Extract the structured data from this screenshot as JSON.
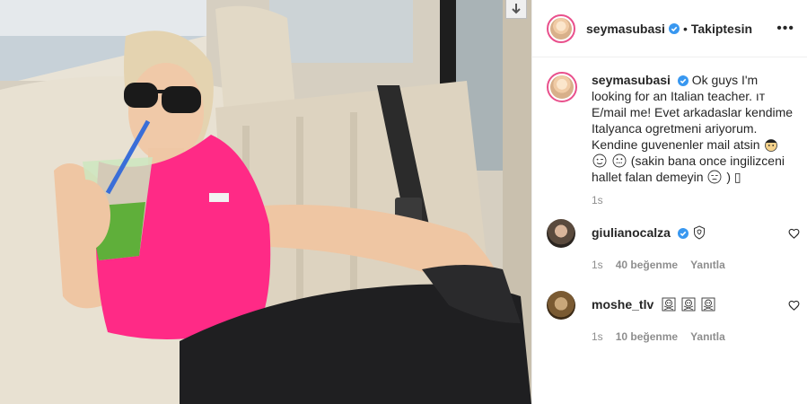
{
  "post": {
    "username": "seymasubasi",
    "separator": "•",
    "follow_status": "Takiptesin",
    "more_label": "•••"
  },
  "caption": {
    "username": "seymasubasi",
    "text": "Ok guys I'm looking for an Italian teacher. 🇮🇹 E/mail me! Evet arkadaslar kendime Italyanca ogretmeni ariyorum. Kendine guvenenler mail atsin",
    "text_after_emojis": "(sakin bana once ingilizceni hallet falan demeyin",
    "text_end": ")",
    "flag_prefix": "ıт",
    "trailing_glyph": "▯",
    "emojis": [
      "detective-emoji",
      "wink-emoji",
      "zipper-mouth-emoji"
    ],
    "end_emoji": "unamused-emoji",
    "time": "1s"
  },
  "comments": [
    {
      "username": "giulianocalza",
      "verified": true,
      "text_emoji": "flexed-shield-emoji",
      "time": "1s",
      "likes": "40 beğenme",
      "reply": "Yanıtla"
    },
    {
      "username": "moshe_tlv",
      "verified": false,
      "text_emojis": [
        "skull-crossbones-emoji",
        "skull-crossbones-emoji",
        "skull-crossbones-emoji"
      ],
      "time": "1s",
      "likes": "10 beğenme",
      "reply": "Yanıtla"
    }
  ],
  "colors": {
    "verified_blue": "#3897f0",
    "story_ring": "#e9508c",
    "top_pink": "#ff2a86"
  }
}
